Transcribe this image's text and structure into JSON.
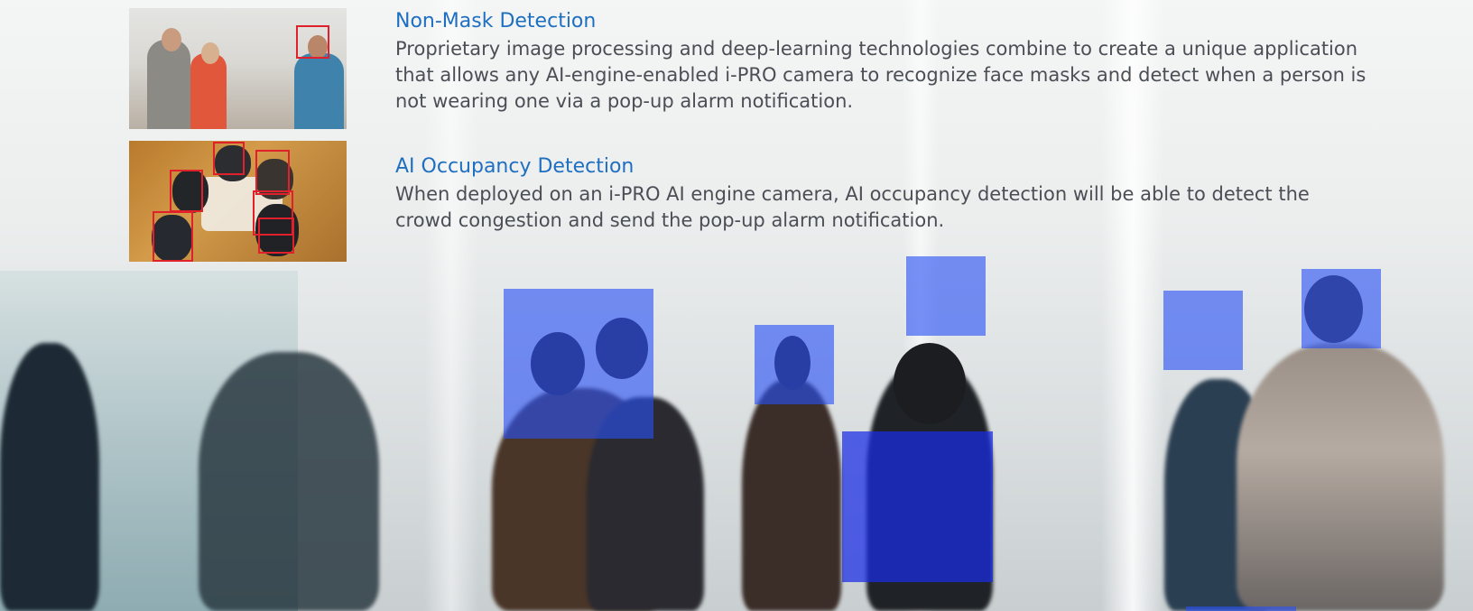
{
  "sections": [
    {
      "title": "Non-Mask Detection",
      "description": "Proprietary image processing and deep-learning technologies combine to create a unique application that allows any AI-engine-enabled i-PRO camera to recognize face masks and detect when a person is not wearing one via a pop-up alarm notification."
    },
    {
      "title": "AI Occupancy Detection",
      "description": "When deployed on an i-PRO AI engine camera, AI occupancy detection will be able to detect the crowd congestion and send the pop-up alarm notification."
    }
  ],
  "colors": {
    "title": "#1f6fc1",
    "body_text": "#4a4f55",
    "detection_box_red": "#e0202b",
    "detection_box_blue": "#2850f5"
  },
  "images": {
    "thumbnail_1": "people-wearing-masks-photo",
    "thumbnail_2": "meeting-table-top-view-photo",
    "background": "blurred-crowd-walking-photo"
  }
}
